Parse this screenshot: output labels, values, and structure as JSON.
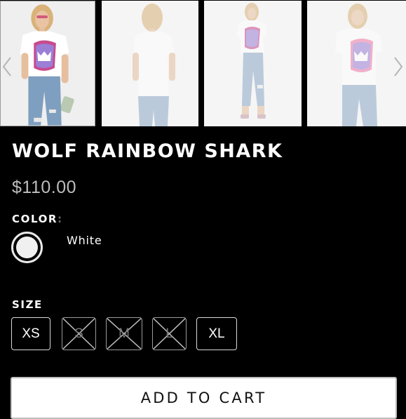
{
  "product": {
    "title": "WOLF RAINBOW SHARK",
    "price": "$110.00"
  },
  "gallery": {
    "images": [
      {
        "name": "model-front-with-clutch",
        "selected": true
      },
      {
        "name": "model-back-view",
        "selected": false
      },
      {
        "name": "model-front-full-length",
        "selected": false
      },
      {
        "name": "model-front-closeup",
        "selected": false
      }
    ],
    "prev_icon": "chevron-left-icon",
    "next_icon": "chevron-right-icon"
  },
  "color": {
    "label": "COLOR",
    "colon": ":",
    "selected": "White",
    "swatch_hex": "#f0f0f0"
  },
  "size": {
    "label": "SIZE",
    "options": [
      {
        "label": "XS",
        "available": true
      },
      {
        "label": "S",
        "available": false
      },
      {
        "label": "M",
        "available": false
      },
      {
        "label": "L",
        "available": false
      },
      {
        "label": "XL",
        "available": true
      }
    ]
  },
  "cart": {
    "add_label": "ADD TO CART"
  },
  "colors": {
    "background": "#000000",
    "text": "#ffffff",
    "price": "#bdbdbd",
    "shark_print": "#9b7fd6",
    "shark_print_accent": "#f07aa8"
  }
}
